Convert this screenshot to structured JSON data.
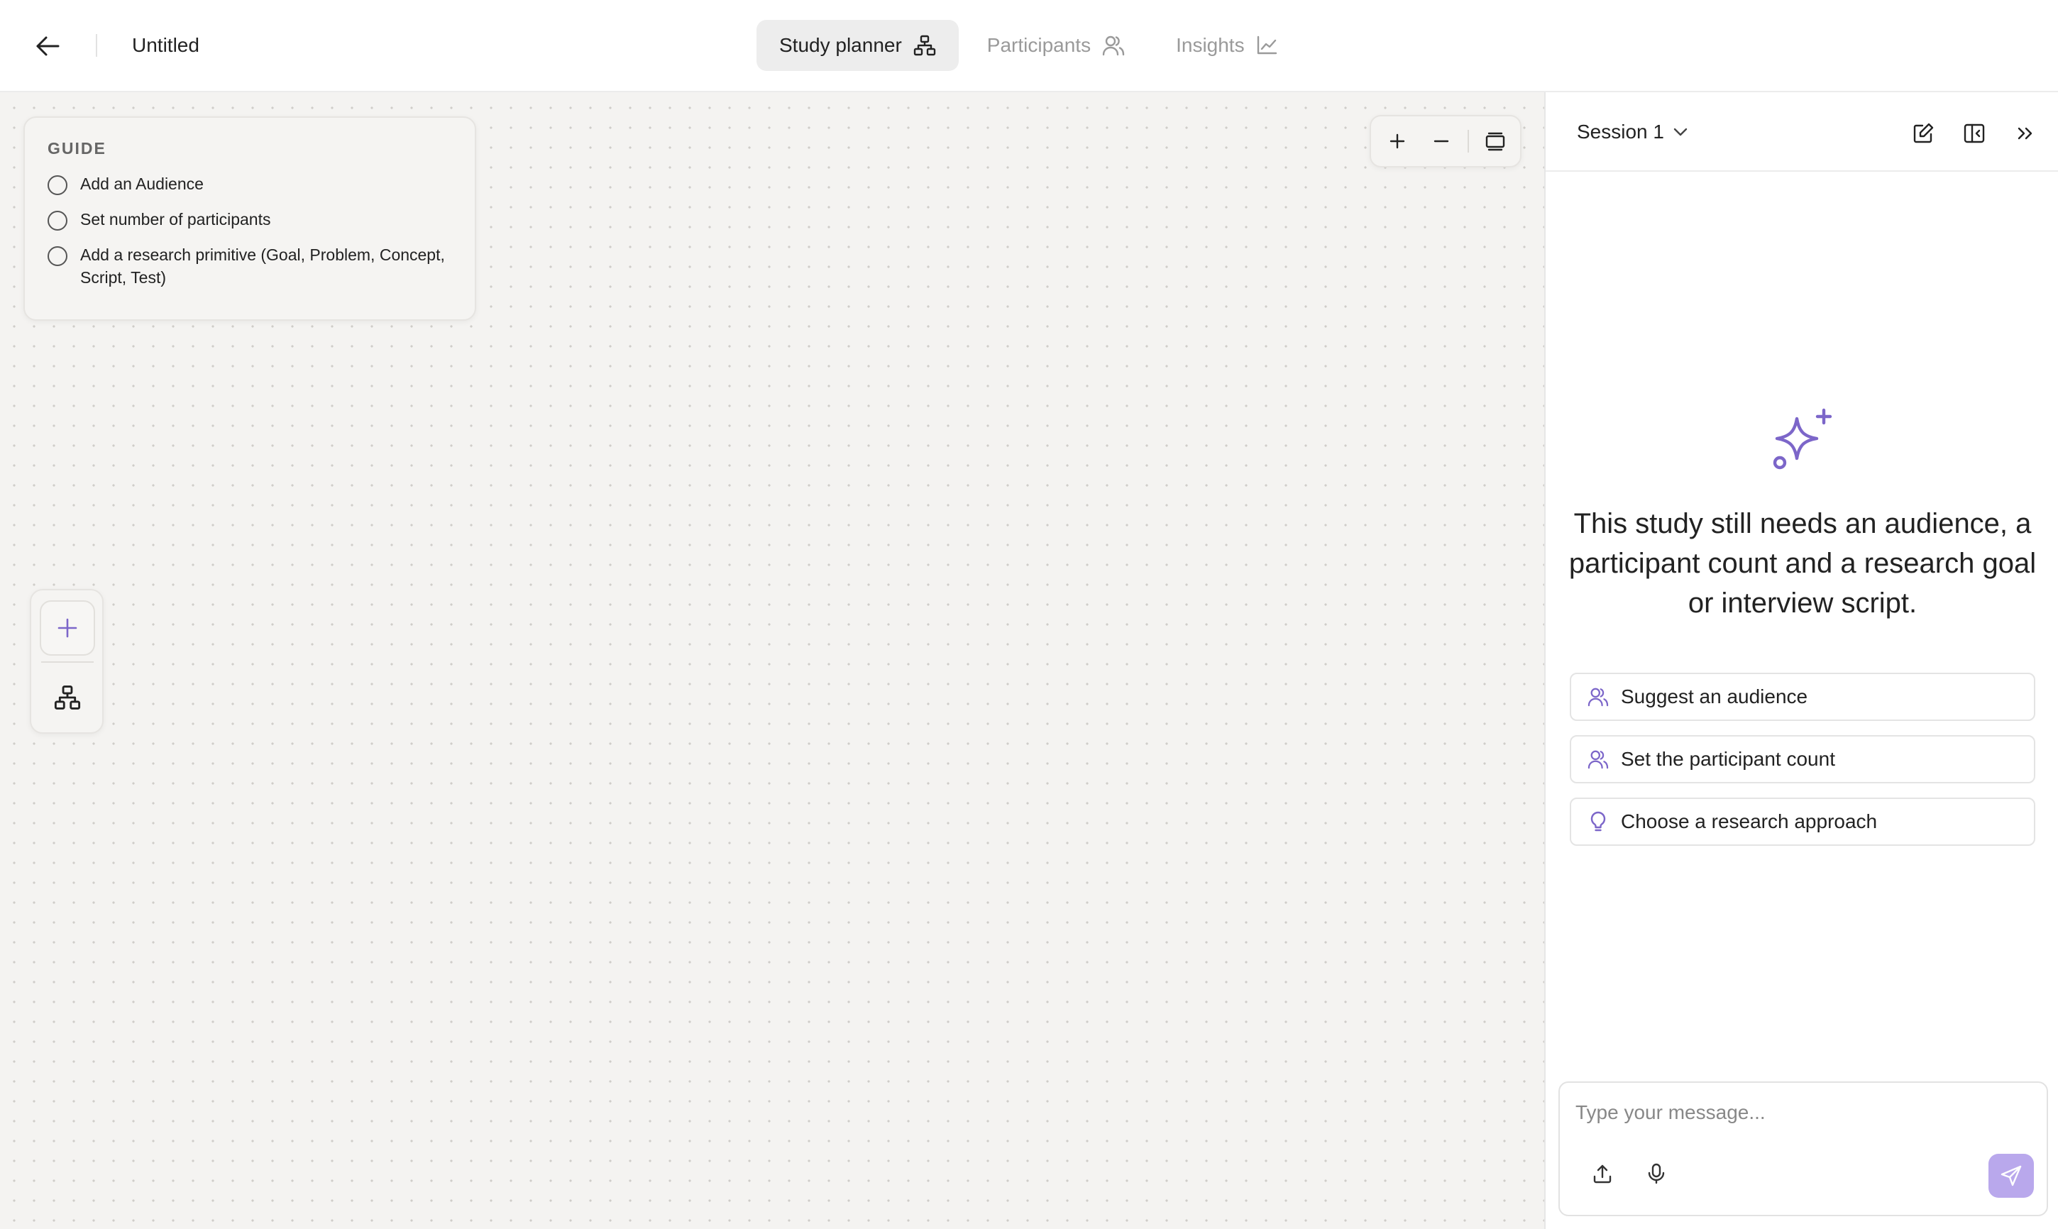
{
  "header": {
    "back_icon": "arrow-left-icon",
    "title": "Untitled",
    "tabs": [
      {
        "label": "Study planner",
        "icon": "sitemap-icon",
        "active": true
      },
      {
        "label": "Participants",
        "icon": "users-icon",
        "active": false
      },
      {
        "label": "Insights",
        "icon": "chart-line-icon",
        "active": false
      }
    ]
  },
  "canvas": {
    "guide": {
      "title": "GUIDE",
      "items": [
        {
          "label": "Add an Audience",
          "checked": false
        },
        {
          "label": "Set number of participants",
          "checked": false
        },
        {
          "label": "Add a research primitive (Goal, Problem, Concept, Script, Test)",
          "checked": false
        }
      ]
    },
    "zoom_controls": [
      "plus-icon",
      "minus-icon",
      "fit-view-icon"
    ],
    "tools": [
      "plus-icon",
      "sitemap-icon"
    ]
  },
  "panel": {
    "session_label": "Session 1",
    "header_icons": [
      "edit-icon",
      "panel-collapse-icon",
      "chevrons-right-icon"
    ],
    "empty_icon": "sparkles-icon",
    "empty_message": "This study still needs an audience, a participant count and a research goal or interview script.",
    "suggestions": [
      {
        "label": "Suggest an audience",
        "icon": "users-icon"
      },
      {
        "label": "Set the participant count",
        "icon": "users-icon"
      },
      {
        "label": "Choose a research approach",
        "icon": "lightbulb-icon"
      }
    ],
    "composer": {
      "placeholder": "Type your message...",
      "value": "",
      "icons": [
        "upload-icon",
        "microphone-icon",
        "send-icon"
      ]
    }
  },
  "colors": {
    "accent": "#7c66c9",
    "send_button": "#b9a8ec",
    "canvas_bg": "#f4f3f1",
    "active_tab_bg": "#ededed"
  }
}
